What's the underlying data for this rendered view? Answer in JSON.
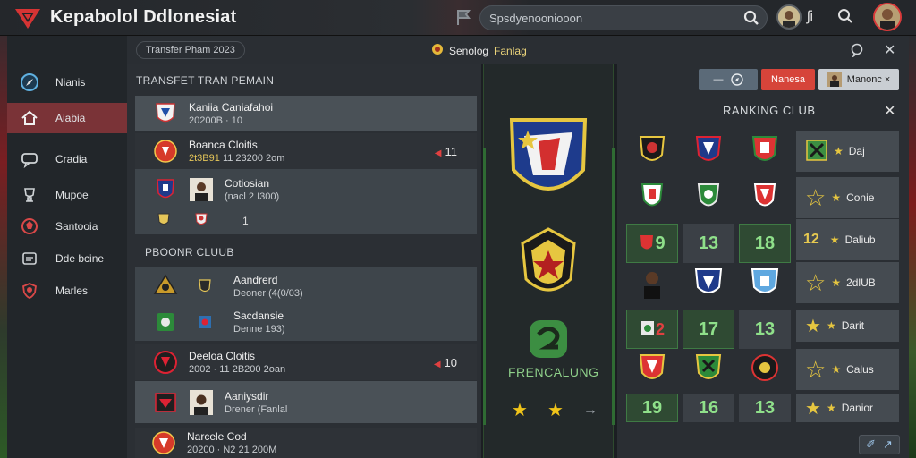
{
  "app": {
    "title": "Kepabolol Ddlonesiat"
  },
  "search": {
    "value": "Spsdyenooniooon"
  },
  "topbar": {
    "pill_text": "ʃi"
  },
  "sidebar": {
    "items": [
      {
        "label": "Nianis",
        "icon": "compass-icon"
      },
      {
        "label": "Aiabia",
        "icon": "home-icon",
        "active": true
      },
      {
        "label": "Cradia",
        "icon": "chat-icon"
      },
      {
        "label": "Mupoe",
        "icon": "trophy-icon"
      },
      {
        "label": "Santooia",
        "icon": "ball-icon"
      },
      {
        "label": "Dde bcine",
        "icon": "card-icon"
      },
      {
        "label": "Marles",
        "icon": "shield-icon"
      }
    ]
  },
  "subheader": {
    "crumb": "Transfer Pham 2023",
    "title_prefix": "Senolog",
    "title_suffix": "Fanlag"
  },
  "transfer": {
    "section_title": "TRANSFET TRAN PEMAIN",
    "rows": [
      {
        "name": "Kaniia Caniafahoi",
        "sub": "20200B  ·  10"
      },
      {
        "name": "Boanca Cloitis",
        "sub_yel": "2t3B91",
        "sub": "11 23200 2om",
        "right": "11"
      },
      {
        "name": "Cotiosian",
        "sub": "(nacl 2 I300)"
      },
      {
        "name": "",
        "sub": "",
        "right": "1"
      }
    ]
  },
  "club": {
    "section_title": "PBOONR CLUUB",
    "rows": [
      {
        "name": "Aandrerd",
        "sub": "Deoner (4(0/03)"
      },
      {
        "name": "Sacdansie",
        "sub": "Denne 193)"
      },
      {
        "name": "Deeloa Cloitis",
        "sub": "2002  ·  11 2B200 2oan",
        "right": "10"
      },
      {
        "name": "Aaniysdir",
        "sub": "Drener (Fanlal"
      },
      {
        "name": "Narcele Cod",
        "sub": "20200  ·  N2 21 200M"
      }
    ]
  },
  "center": {
    "label": "FRENCALUNG"
  },
  "ranking": {
    "title": "RANKING CLUB",
    "btn_blue": "—",
    "btn_red": "Nanesa",
    "btn_user": "Manonc ×",
    "grid_numbers": [
      "9",
      "13",
      "18",
      "17",
      "13",
      "19",
      "16",
      "13"
    ],
    "cards": [
      {
        "label": "Daj"
      },
      {
        "label": "Conie"
      },
      {
        "num": "12",
        "label": "Daliub"
      },
      {
        "label": "2dlUB"
      },
      {
        "label": "Darit"
      },
      {
        "label": "Calus"
      },
      {
        "label": "Danior"
      }
    ]
  },
  "colors": {
    "accent_red": "#7a3337",
    "green": "#2f6b33",
    "gold": "#e6c950"
  }
}
